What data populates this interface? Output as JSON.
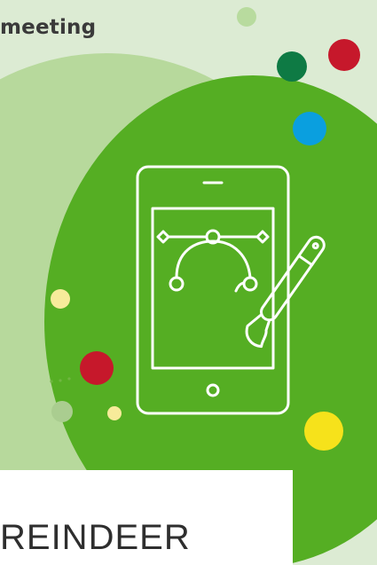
{
  "heading": "meeting",
  "brand": "REINDEER",
  "icons": {
    "illustration": "tablet-bezier-paintbrush-icon"
  },
  "colors": {
    "page_background": "#dcebd3",
    "light_green_blob": "#a9d48b",
    "green_blob": "#55ae23",
    "white_panel": "#ffffff",
    "dark_green_dot": "#0e7a44",
    "red_dot": "#c6182b",
    "blue_dot": "#0a9fdf",
    "yellow_dot": "#f6e21b",
    "pale_yellow_dot": "#f7eb9a",
    "pale_green_dot": "#aacd90",
    "text": "#333333"
  }
}
